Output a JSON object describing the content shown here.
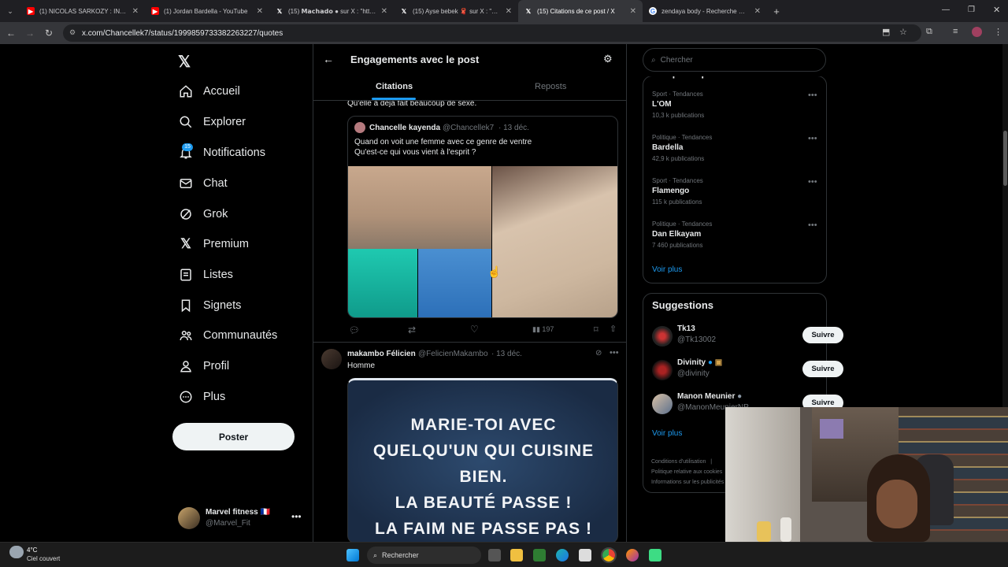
{
  "browser": {
    "tabs": [
      {
        "title": "(1) NICOLAS SARKOZY : INTERVI",
        "icon": "youtube-icon"
      },
      {
        "title": "(1) Jordan Bardella - YouTube",
        "icon": "youtube-icon"
      },
      {
        "title": "(15) 𝗠𝗮𝗰𝗵𝗮𝗱𝗼 ● sur X : \"https:",
        "icon": "x-icon"
      },
      {
        "title": "(15) Ayse bebek 🧣 sur X : \"@M",
        "icon": "x-icon"
      },
      {
        "title": "(15) Citations de ce post / X",
        "icon": "x-icon"
      },
      {
        "title": "zendaya body - Recherche Goo",
        "icon": "google-icon"
      }
    ],
    "url": "x.com/Chancellek7/status/1999859733382263227/quotes"
  },
  "nav": {
    "items": [
      {
        "label": "Accueil",
        "icon": "home-icon"
      },
      {
        "label": "Explorer",
        "icon": "search-icon"
      },
      {
        "label": "Notifications",
        "icon": "bell-icon"
      },
      {
        "label": "Chat",
        "icon": "mail-icon"
      },
      {
        "label": "Grok",
        "icon": "grok-icon"
      },
      {
        "label": "Premium",
        "icon": "x-logo-icon"
      },
      {
        "label": "Listes",
        "icon": "list-icon"
      },
      {
        "label": "Signets",
        "icon": "bookmark-icon"
      },
      {
        "label": "Communautés",
        "icon": "communities-icon"
      },
      {
        "label": "Profil",
        "icon": "profile-icon"
      },
      {
        "label": "Plus",
        "icon": "more-icon"
      }
    ],
    "notif_count": "15",
    "post_label": "Poster"
  },
  "account": {
    "name": "Marvel fitness 🇫🇷",
    "handle": "@Marvel_Fit"
  },
  "header": {
    "title": "Engagements avec le post",
    "tab_quotes": "Citations",
    "tab_reposts": "Reposts"
  },
  "post1": {
    "partial_text": "Qu'elle a déjà fait beaucoup de sexe.",
    "quoted": {
      "name": "Chancelle kayenda",
      "handle": "@Chancellek7",
      "date": "· 13 déc.",
      "line1": "Quand on voit une femme avec ce genre de ventre",
      "line2": "Qu'est-ce qui vous vient à l'esprit ?"
    },
    "views": "197"
  },
  "post2": {
    "name": "makambo Félicien",
    "handle": "@FelicienMakambo",
    "date": "· 13 déc.",
    "text": "Homme",
    "image_lines": [
      "MARIE-TOI AVEC",
      "QUELQU'UN QUI CUISINE",
      "BIEN.",
      "LA BEAUTÉ PASSE !",
      "LA FAIM NE PASSE PAS !"
    ]
  },
  "right": {
    "search_placeholder": "Chercher",
    "trends_title": "Ce qui se passe",
    "trends": [
      {
        "cat": "Sport · Tendances",
        "name": "L'OM",
        "count": "10,3 k publications"
      },
      {
        "cat": "Politique · Tendances",
        "name": "Bardella",
        "count": "42,9 k publications"
      },
      {
        "cat": "Sport · Tendances",
        "name": "Flamengo",
        "count": "115 k publications"
      },
      {
        "cat": "Politique · Tendances",
        "name": "Dan Elkayam",
        "count": "7 460 publications"
      }
    ],
    "see_more": "Voir plus",
    "suggestions_title": "Suggestions",
    "suggestions": [
      {
        "name": "Tk13",
        "handle": "@Tk13002",
        "follow": "Suivre"
      },
      {
        "name": "Divinity",
        "handle": "@divinity",
        "follow": "Suivre"
      },
      {
        "name": "Manon Meunier",
        "handle": "@ManonMeunierNP",
        "follow": "Suivre"
      }
    ],
    "see_more2": "Voir plus",
    "footer": [
      "Conditions d'utilisation",
      "|",
      "Politique relative aux cookies",
      "Informations sur les publicités"
    ]
  },
  "taskbar": {
    "temp": "4°C",
    "weather": "Ciel couvert",
    "search": "Rechercher"
  }
}
